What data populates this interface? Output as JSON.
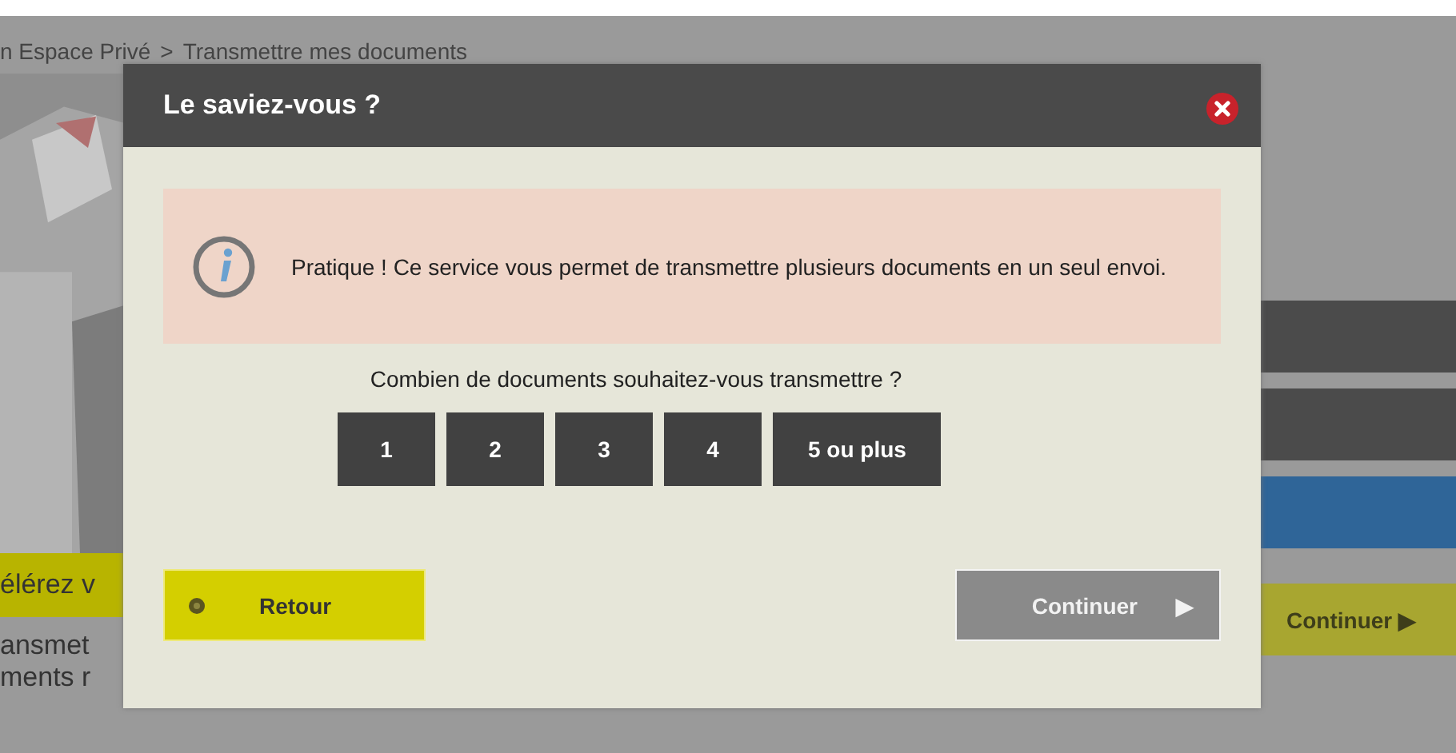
{
  "breadcrumb": {
    "items": [
      "n Espace Privé",
      ">",
      "Transmettre mes documents"
    ]
  },
  "background": {
    "banner_text": "élérez v",
    "lines": [
      "ansmet",
      "ments r"
    ],
    "continue_button": {
      "label": "Continuer",
      "icon": "▶"
    }
  },
  "dialog": {
    "title": "Le saviez-vous ?",
    "info": "Pratique ! Ce service vous permet de transmettre plusieurs documents en un seul envoi.",
    "question": "Combien de documents souhaitez-vous transmettre ?",
    "choices": [
      "1",
      "2",
      "3",
      "4",
      "5 ou plus"
    ],
    "back_button": {
      "label": "Retour"
    },
    "continue_button": {
      "label": "Continuer",
      "icon": "▶"
    }
  }
}
